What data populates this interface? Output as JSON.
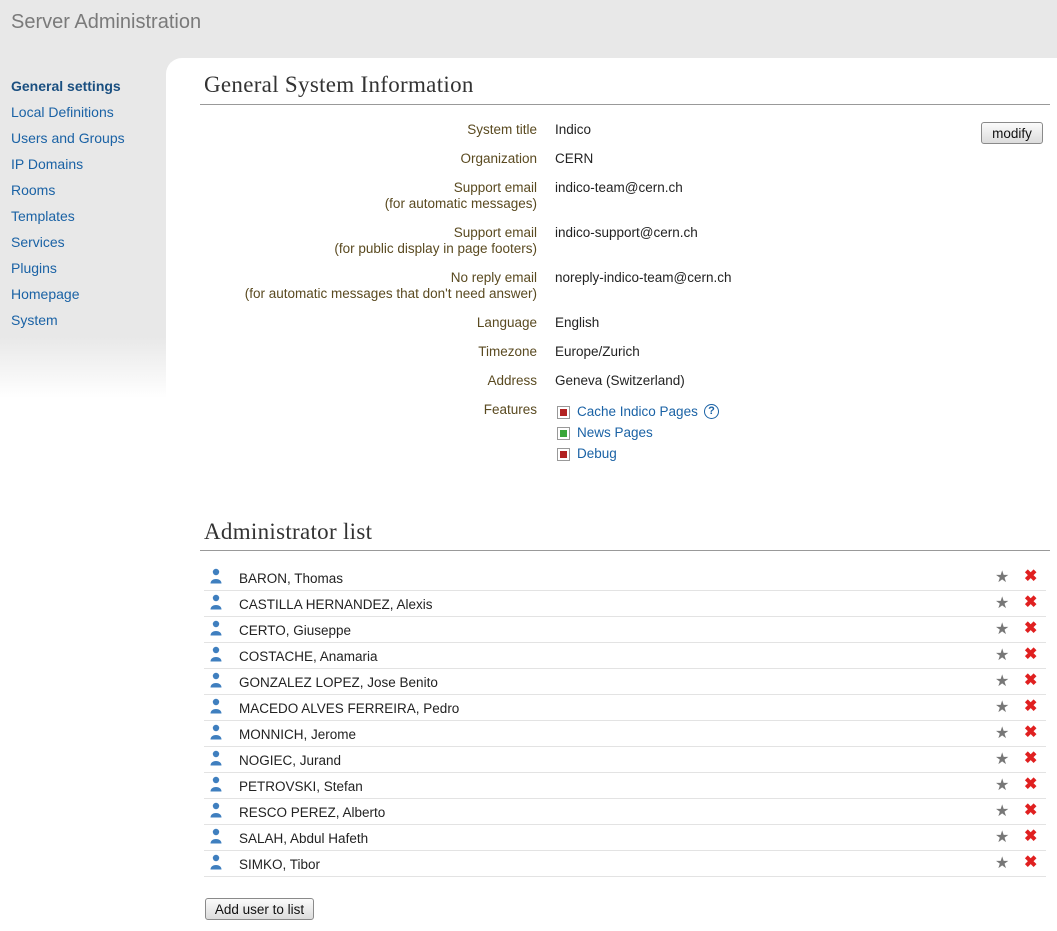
{
  "header": {
    "title": "Server Administration"
  },
  "sidebar": {
    "items": [
      {
        "label": "General settings",
        "active": true
      },
      {
        "label": "Local Definitions"
      },
      {
        "label": "Users and Groups"
      },
      {
        "label": "IP Domains"
      },
      {
        "label": "Rooms"
      },
      {
        "label": "Templates"
      },
      {
        "label": "Services"
      },
      {
        "label": "Plugins"
      },
      {
        "label": "Homepage"
      },
      {
        "label": "System"
      }
    ]
  },
  "general": {
    "title": "General System Information",
    "modify_label": "modify",
    "rows": [
      {
        "label": "System title",
        "sublabel": "",
        "value": "Indico"
      },
      {
        "label": "Organization",
        "sublabel": "",
        "value": "CERN"
      },
      {
        "label": "Support email",
        "sublabel": "(for automatic messages)",
        "value": "indico-team@cern.ch"
      },
      {
        "label": "Support email",
        "sublabel": "(for public display in page footers)",
        "value": "indico-support@cern.ch"
      },
      {
        "label": "No reply email",
        "sublabel": "(for automatic messages that don't need answer)",
        "value": "noreply-indico-team@cern.ch"
      },
      {
        "label": "Language",
        "sublabel": "",
        "value": "English"
      },
      {
        "label": "Timezone",
        "sublabel": "",
        "value": "Europe/Zurich"
      },
      {
        "label": "Address",
        "sublabel": "",
        "value": "Geneva (Switzerland)"
      }
    ],
    "features_label": "Features",
    "features": [
      {
        "label": "Cache Indico Pages",
        "enabled": false,
        "color": "#b22222"
      },
      {
        "label": "News Pages",
        "enabled": true,
        "color": "#3aa63a"
      },
      {
        "label": "Debug",
        "enabled": false,
        "color": "#b22222"
      }
    ],
    "help_glyph": "?"
  },
  "admins": {
    "title": "Administrator list",
    "users": [
      "BARON, Thomas",
      "CASTILLA HERNANDEZ, Alexis",
      "CERTO, Giuseppe",
      "COSTACHE, Anamaria",
      "GONZALEZ LOPEZ, Jose Benito",
      "MACEDO ALVES FERREIRA, Pedro",
      "MONNICH, Jerome",
      "NOGIEC, Jurand",
      "PETROVSKI, Stefan",
      "RESCO PEREZ, Alberto",
      "SALAH, Abdul Hafeth",
      "SIMKO, Tibor"
    ],
    "add_label": "Add user to list"
  },
  "icons": {
    "user": "user-icon",
    "star": "star-icon",
    "remove": "remove-icon",
    "help": "help-icon"
  },
  "colors": {
    "link": "#1a62a5",
    "label": "#5a4a20",
    "remove": "#e02020",
    "user_icon": "#3f7fbf"
  }
}
